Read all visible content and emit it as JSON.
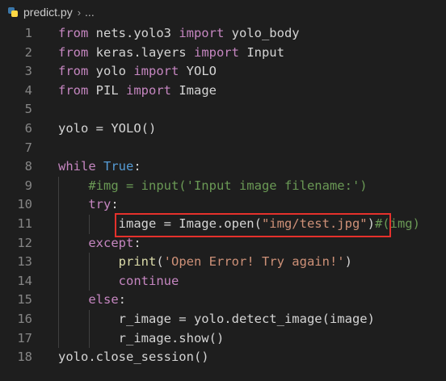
{
  "breadcrumb": {
    "file": "predict.py",
    "separator": "›",
    "rest": "..."
  },
  "lines": [
    {
      "n": "1",
      "tokens": [
        [
          "kw",
          "from"
        ],
        [
          "pl",
          " nets.yolo3 "
        ],
        [
          "kw",
          "import"
        ],
        [
          "pl",
          " yolo_body"
        ]
      ]
    },
    {
      "n": "2",
      "tokens": [
        [
          "kw",
          "from"
        ],
        [
          "pl",
          " keras.layers "
        ],
        [
          "kw",
          "import"
        ],
        [
          "pl",
          " Input"
        ]
      ]
    },
    {
      "n": "3",
      "tokens": [
        [
          "kw",
          "from"
        ],
        [
          "pl",
          " yolo "
        ],
        [
          "kw",
          "import"
        ],
        [
          "pl",
          " YOLO"
        ]
      ]
    },
    {
      "n": "4",
      "tokens": [
        [
          "kw",
          "from"
        ],
        [
          "pl",
          " PIL "
        ],
        [
          "kw",
          "import"
        ],
        [
          "pl",
          " Image"
        ]
      ]
    },
    {
      "n": "5",
      "tokens": []
    },
    {
      "n": "6",
      "tokens": [
        [
          "pl",
          "yolo = YOLO()"
        ]
      ]
    },
    {
      "n": "7",
      "tokens": []
    },
    {
      "n": "8",
      "tokens": [
        [
          "kw",
          "while"
        ],
        [
          "pl",
          " "
        ],
        [
          "bl",
          "True"
        ],
        [
          "pl",
          ":"
        ]
      ]
    },
    {
      "n": "9",
      "tokens": [
        [
          "pl",
          "    "
        ],
        [
          "cm",
          "#img = input('Input image filename:')"
        ]
      ]
    },
    {
      "n": "10",
      "tokens": [
        [
          "pl",
          "    "
        ],
        [
          "kw",
          "try"
        ],
        [
          "pl",
          ":"
        ]
      ]
    },
    {
      "n": "11",
      "tokens": [
        [
          "pl",
          "        image = Image.open("
        ],
        [
          "st",
          "\"img/test.jpg\""
        ],
        [
          "pl",
          ")"
        ],
        [
          "cm",
          "#(img)"
        ]
      ]
    },
    {
      "n": "12",
      "tokens": [
        [
          "pl",
          "    "
        ],
        [
          "kw",
          "except"
        ],
        [
          "pl",
          ":"
        ]
      ]
    },
    {
      "n": "13",
      "tokens": [
        [
          "pl",
          "        "
        ],
        [
          "fn",
          "print"
        ],
        [
          "pl",
          "("
        ],
        [
          "st",
          "'Open Error! Try again!'"
        ],
        [
          "pl",
          ")"
        ]
      ]
    },
    {
      "n": "14",
      "tokens": [
        [
          "pl",
          "        "
        ],
        [
          "kw",
          "continue"
        ]
      ]
    },
    {
      "n": "15",
      "tokens": [
        [
          "pl",
          "    "
        ],
        [
          "kw",
          "else"
        ],
        [
          "pl",
          ":"
        ]
      ]
    },
    {
      "n": "16",
      "tokens": [
        [
          "pl",
          "        r_image = yolo.detect_image(image)"
        ]
      ]
    },
    {
      "n": "17",
      "tokens": [
        [
          "pl",
          "        r_image.show()"
        ]
      ]
    },
    {
      "n": "18",
      "tokens": [
        [
          "pl",
          "yolo.close_session()"
        ]
      ]
    }
  ],
  "colors": {
    "background": "#1e1e1e",
    "keyword": "#c586c0",
    "builtin_constant": "#569cd6",
    "function": "#dcdcaa",
    "string": "#ce9178",
    "comment": "#6a9955",
    "plain": "#d4d4d4",
    "line_number": "#858585",
    "highlight_box": "#e5312c"
  },
  "icons": {
    "file_icon": "python-file-icon"
  }
}
